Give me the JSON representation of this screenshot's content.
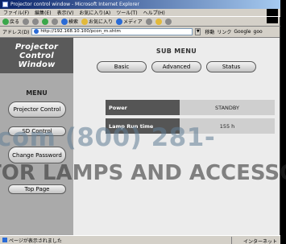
{
  "window": {
    "title": "Projector control window - Microsoft Internet Explorer"
  },
  "menubar": {
    "items": [
      "ファイル(F)",
      "編集(E)",
      "表示(V)",
      "お気に入り(A)",
      "ツール(T)",
      "ヘルプ(H)"
    ]
  },
  "toolbar": {
    "back_label": "戻る",
    "search_label": "検索",
    "favorites_label": "お気に入り",
    "media_label": "メディア"
  },
  "addressbar": {
    "label": "アドレス(D)",
    "url": "http://192.168.10.100/pcon_m.shtm",
    "go_label": "移動",
    "links_label": "リンク",
    "link_google": "Google",
    "link_goo": "goo"
  },
  "sidebar": {
    "logo_lines": [
      "Projector",
      "Control",
      "Window"
    ],
    "menu_title": "MENU",
    "buttons": {
      "projector_control": "Projector Control",
      "sd_control": "SD Control",
      "change_password": "Change Password",
      "top_page": "Top Page"
    }
  },
  "main": {
    "submenu_title": "SUB MENU",
    "tabs": {
      "basic": "Basic",
      "advanced": "Advanced",
      "status": "Status"
    },
    "status_rows": [
      {
        "label": "Power",
        "value": "STANDBY"
      },
      {
        "label": "Lamp Run time",
        "value": "155 h"
      }
    ]
  },
  "statusbar": {
    "text": "ページが表示されました",
    "zone": "インターネット"
  },
  "watermark": {
    "line1": "com (800) 281-",
    "line2": "TOR LAMPS AND ACCESSO"
  },
  "colors": {
    "sidebar_bg": "#aaaaaa",
    "logo_bg": "#5a5a5a",
    "label_cell_bg": "#555555",
    "value_cell_bg": "#cfcfcf",
    "main_bg": "#ececec"
  }
}
